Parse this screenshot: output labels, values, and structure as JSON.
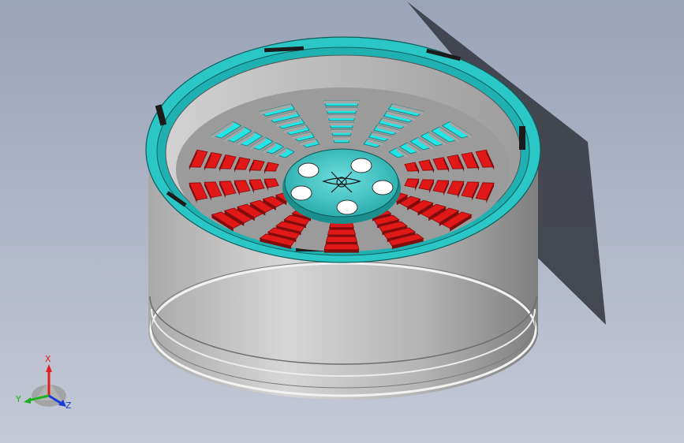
{
  "viewport": {
    "background_top": "#9aa3b8",
    "background_bottom": "#c4c9d6"
  },
  "model": {
    "name": "wheel-rim",
    "colors": {
      "body": "#c9c9c9",
      "body_dark": "#8f8f8f",
      "flange": "#2bc6c6",
      "spoke_face_cyan": "#22e6e6",
      "spoke_face_red": "#e01818",
      "spoke_edge": "#8a0a0a",
      "hub": "#38c9c9",
      "shadow": "#3a3d44"
    }
  },
  "triad": {
    "x_label": "X",
    "y_label": "Y",
    "z_label": "Z",
    "x_color": "#e02020",
    "y_color": "#1fb01f",
    "z_color": "#1a3bd8"
  }
}
